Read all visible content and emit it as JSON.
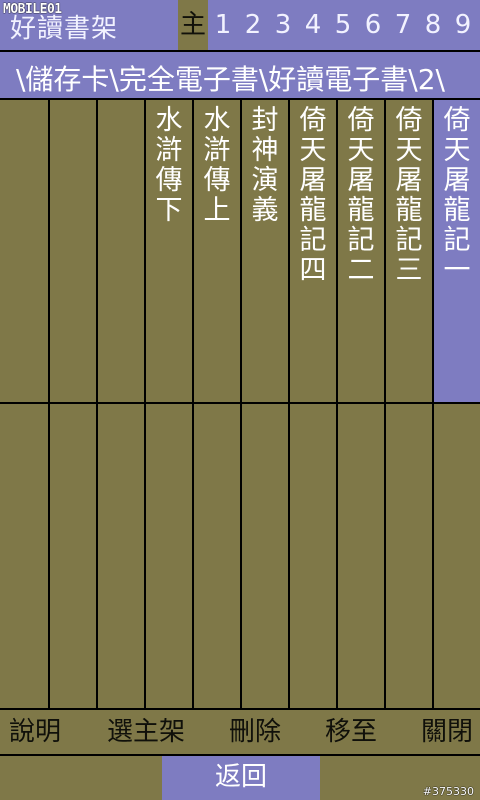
{
  "header": {
    "logo_text": "MOBILE01",
    "title": "好讀書架",
    "tabs": [
      {
        "label": "主",
        "active": true
      },
      {
        "label": "1"
      },
      {
        "label": "2"
      },
      {
        "label": "3"
      },
      {
        "label": "4"
      },
      {
        "label": "5"
      },
      {
        "label": "6"
      },
      {
        "label": "7"
      },
      {
        "label": "8"
      },
      {
        "label": "9"
      }
    ]
  },
  "path": "\\儲存卡\\完全電子書\\好讀電子書\\2\\",
  "books": [
    {
      "title": "",
      "selected": false
    },
    {
      "title": "",
      "selected": false
    },
    {
      "title": "",
      "selected": false
    },
    {
      "title": "水滸傳下",
      "selected": false
    },
    {
      "title": "水滸傳上",
      "selected": false
    },
    {
      "title": "封神演義",
      "selected": false
    },
    {
      "title": "倚天屠龍記四",
      "selected": false
    },
    {
      "title": "倚天屠龍記二",
      "selected": false
    },
    {
      "title": "倚天屠龍記三",
      "selected": false
    },
    {
      "title": "倚天屠龍記一",
      "selected": true
    }
  ],
  "footer": {
    "help": "說明",
    "select_shelf": "選主架",
    "delete": "刪除",
    "move_to": "移至",
    "close": "關閉",
    "back": "返回"
  },
  "watermark": "#375330",
  "colors": {
    "olive": "#7f7848",
    "lavender": "#7e7cc1"
  }
}
